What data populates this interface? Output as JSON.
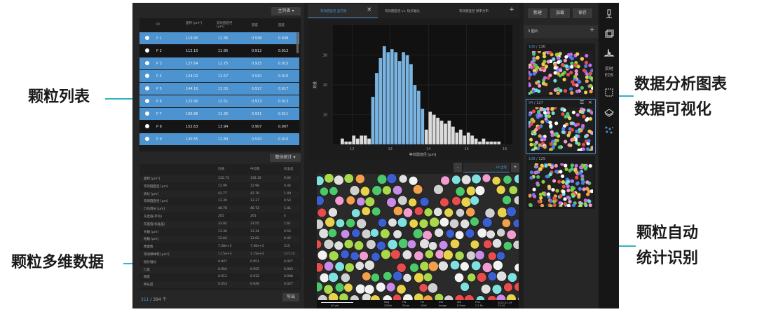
{
  "callouts": {
    "particle_list": "颗粒列表",
    "multi_data": "颗粒多维数据",
    "analysis_line1": "数据分析图表",
    "analysis_line2": "数据可视化",
    "auto_line1": "颗粒自动",
    "auto_line2": "统计识别"
  },
  "colors": {
    "accent": "#2eb4c4",
    "selected_row": "#4d93cf",
    "bar_blue": "#7bb4e0",
    "bar_gray": "#dcdcdc"
  },
  "left_panel": {
    "top_dropdown": "主列表",
    "columns": [
      "ID",
      "面积 [μm²]",
      "等效圆直径 [μm]",
      "圆度",
      "圆度"
    ],
    "rows": [
      {
        "id": "P 1",
        "area": "119.95",
        "ecd": "12.36",
        "c1": "0.938",
        "c2": "0.938",
        "selected": true
      },
      {
        "id": "P 2",
        "area": "112.10",
        "ecd": "11.95",
        "c1": "0.912",
        "c2": "0.912",
        "selected": false
      },
      {
        "id": "P 3",
        "area": "127.64",
        "ecd": "12.75",
        "c1": "0.915",
        "c2": "0.915",
        "selected": true
      },
      {
        "id": "P 4",
        "area": "124.02",
        "ecd": "12.57",
        "c1": "0.910",
        "c2": "0.910",
        "selected": true
      },
      {
        "id": "P 5",
        "area": "144.16",
        "ecd": "13.55",
        "c1": "0.917",
        "c2": "0.917",
        "selected": true
      },
      {
        "id": "P 6",
        "area": "122.90",
        "ecd": "12.51",
        "c1": "0.913",
        "c2": "0.913",
        "selected": true
      },
      {
        "id": "P 7",
        "area": "106.86",
        "ecd": "11.35",
        "c1": "0.911",
        "c2": "0.911",
        "selected": true
      },
      {
        "id": "P 8",
        "area": "152.63",
        "ecd": "13.94",
        "c1": "0.907",
        "c2": "0.907",
        "selected": false
      },
      {
        "id": "P 9",
        "area": "130.55",
        "ecd": "12.89",
        "c1": "0.910",
        "c2": "0.910",
        "selected": true
      }
    ],
    "mid_dropdown": "整体统计",
    "stats_columns": [
      "均值",
      "中位数",
      "标准差"
    ],
    "stats": [
      [
        "面积 [μm²]",
        "132.73",
        "132.32",
        "9.02"
      ],
      [
        "等效圆直径 [μm]",
        "12.99",
        "12.98",
        "0.44"
      ],
      [
        "周长 [μm]",
        "42.77",
        "42.76",
        "1.49"
      ],
      [
        "等周圆直径 [μm]",
        "13.39",
        "13.37",
        "0.54"
      ],
      [
        "凸包周长 [μm]",
        "40.78",
        "40.72",
        "1.41"
      ],
      [
        "灰度值(平均)",
        "205",
        "205",
        "4"
      ],
      [
        "灰度值(标准差)",
        "33.92",
        "33.55",
        "1.61"
      ],
      [
        "长轴 [μm]",
        "13.36",
        "13.34",
        "0.55"
      ],
      [
        "短轴 [μm]",
        "12.64",
        "12.62",
        "0.42"
      ],
      [
        "像素数",
        "7.38e+3",
        "7.36e+3",
        "515"
      ],
      [
        "等效球体积 [μm³]",
        "1.15e+3",
        "1.15e+3",
        "117.12"
      ],
      [
        "短长轴比",
        "0.947",
        "0.951",
        "0.027"
      ],
      [
        "凸度",
        "0.954",
        "0.955",
        "0.003"
      ],
      [
        "圆度",
        "0.911",
        "0.912",
        "0.008"
      ],
      [
        "伸长度",
        "0.053",
        "0.049",
        "0.027"
      ]
    ],
    "count_selected": "311",
    "count_total": " / 394 个",
    "bottom_button": "导出"
  },
  "tabs": [
    {
      "label": "等效圆直径 直方图",
      "active": true
    },
    {
      "label": "等效圆直径 vs. 短长轴比",
      "active": false
    },
    {
      "label": "等效圆直径 频率分布",
      "active": false
    }
  ],
  "tab_close": "×",
  "tab_add": "+",
  "chart_data": {
    "type": "bar",
    "xlabel": "等效圆直径 [μm]",
    "ylabel": "数量",
    "ylim": [
      0,
      40
    ],
    "xlim": [
      11.5,
      16.2
    ],
    "x_ticks": [
      "12",
      "13",
      "14",
      "15",
      "16"
    ],
    "y_ticks": [
      "10",
      "20",
      "30"
    ],
    "bin_start": 11.7,
    "bin_width": 0.1,
    "values": [
      2,
      1,
      1,
      3,
      2,
      3,
      3,
      2,
      16,
      24,
      29,
      33,
      31,
      32,
      31,
      28,
      31,
      30,
      27,
      20,
      18,
      12,
      5,
      11,
      10,
      9,
      8,
      7,
      8,
      6,
      4,
      5,
      3,
      4,
      3,
      2,
      1,
      2,
      1,
      1,
      1,
      1
    ],
    "highlight_range": [
      8,
      21
    ]
  },
  "chart_controls": {
    "minus": "-",
    "value": "30 出现",
    "plus": "+"
  },
  "image_info": {
    "scale_label": "40 μm",
    "fields": [
      "Mag",
      "FW",
      "HV",
      "Det",
      "WD",
      "Pres"
    ],
    "values": [
      "2000×",
      "57μm",
      "15kV",
      "Image",
      "8.5mm",
      "2.1 Pa"
    ],
    "timestamp": "2022-01-19 13:24"
  },
  "right_panel": {
    "buttons": [
      "新建",
      "加载",
      "保存"
    ],
    "header": "3 图片",
    "add": "+",
    "thumbnails": [
      {
        "sel": "106",
        "total": " / 136",
        "active": false
      },
      {
        "sel": "94",
        "total": " / 127",
        "active": true
      },
      {
        "sel": "108",
        "total": " / 129",
        "active": false
      }
    ]
  },
  "sidebar": {
    "eds_line1": "实时",
    "eds_line2": "EDS"
  }
}
